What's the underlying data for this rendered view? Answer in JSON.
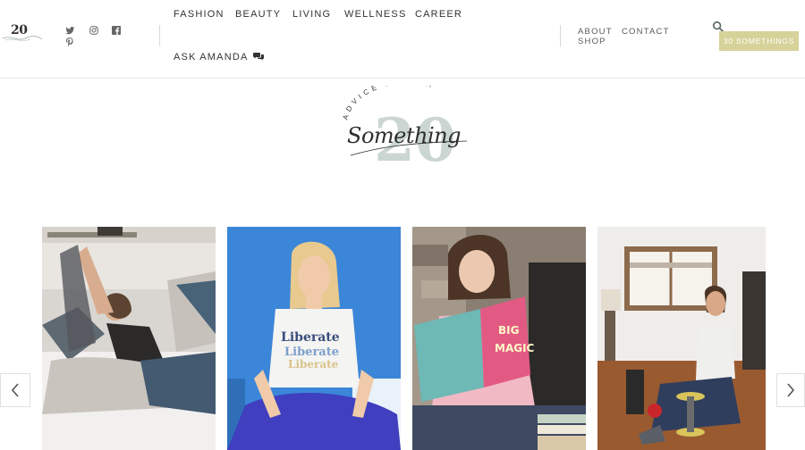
{
  "header": {
    "mini_logo_text": "20",
    "social_icons": [
      "twitter-icon",
      "instagram-icon",
      "facebook-icon",
      "pinterest-icon"
    ],
    "nav_main": [
      "FASHION",
      "BEAUTY",
      "LIVING",
      "WELLNESS",
      "CAREER",
      "ASK AMANDA"
    ],
    "nav_secondary": [
      "ABOUT",
      "CONTACT",
      "SHOP"
    ],
    "cta_label": "30 SOMETHINGS",
    "chat_icon": "chat-bubbles-icon",
    "search_icon": "search-icon"
  },
  "logo": {
    "arc_text": "ADVICE FROM A",
    "script_text": "Something",
    "numeral": "20"
  },
  "carousel": {
    "slides": [
      {
        "label": "woman-relaxing-on-couch-with-blanket"
      },
      {
        "label": "woman-in-liberate-shirt-blue-wall"
      },
      {
        "label": "woman-reading-big-magic-book"
      },
      {
        "label": "woman-exercising-with-weights"
      }
    ],
    "prev_icon": "chevron-left-icon",
    "next_icon": "chevron-right-icon"
  },
  "colors": {
    "accent": "#d7d29a",
    "logo_numeral": "#cbd6d2",
    "text": "#333333"
  }
}
